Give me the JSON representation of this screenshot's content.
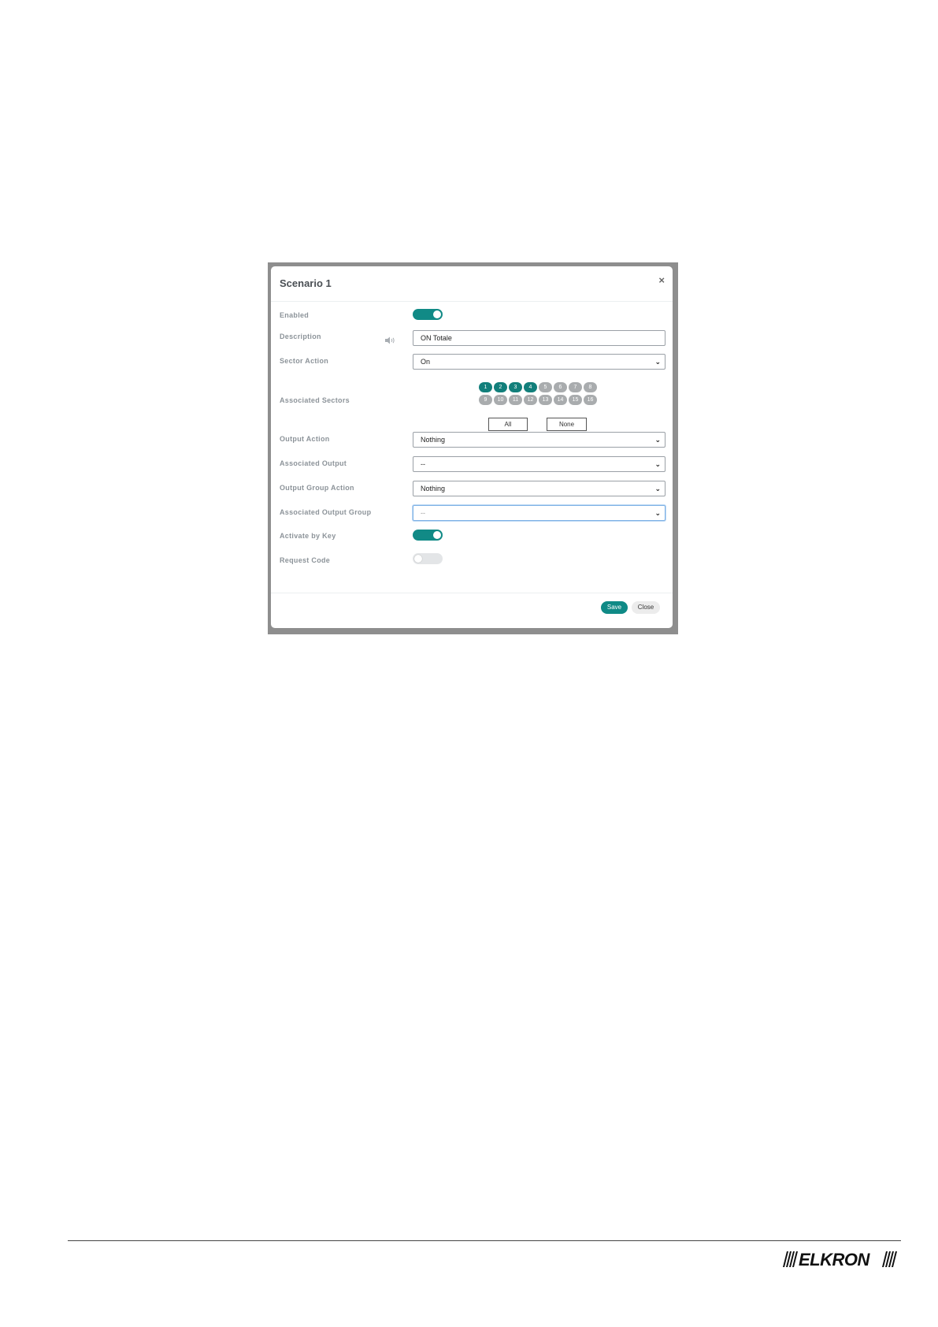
{
  "dialog": {
    "title": "Scenario 1",
    "close_icon": "close-icon"
  },
  "fields": {
    "enabled_label": "Enabled",
    "enabled_value": true,
    "description_label": "Description",
    "description_value": "ON  Totale",
    "sector_action_label": "Sector Action",
    "sector_action_value": "On",
    "associated_sectors_label": "Associated Sectors",
    "output_action_label": "Output Action",
    "output_action_value": "Nothing",
    "associated_output_label": "Associated Output",
    "associated_output_value": "--",
    "output_group_action_label": "Output Group Action",
    "output_group_action_value": "Nothing",
    "associated_output_group_label": "Associated Output Group",
    "associated_output_group_value": "--",
    "activate_by_key_label": "Activate by Key",
    "activate_by_key_value": true,
    "request_code_label": "Request Code",
    "request_code_value": false
  },
  "sectors": {
    "items": [
      {
        "label": "1",
        "selected": true
      },
      {
        "label": "2",
        "selected": true
      },
      {
        "label": "3",
        "selected": true
      },
      {
        "label": "4",
        "selected": true
      },
      {
        "label": "5",
        "selected": false
      },
      {
        "label": "6",
        "selected": false
      },
      {
        "label": "7",
        "selected": false
      },
      {
        "label": "8",
        "selected": false
      },
      {
        "label": "9",
        "selected": false
      },
      {
        "label": "10",
        "selected": false
      },
      {
        "label": "11",
        "selected": false
      },
      {
        "label": "12",
        "selected": false
      },
      {
        "label": "13",
        "selected": false
      },
      {
        "label": "14",
        "selected": false
      },
      {
        "label": "15",
        "selected": false
      },
      {
        "label": "16",
        "selected": false
      }
    ],
    "all_label": "All",
    "none_label": "None"
  },
  "buttons": {
    "save_label": "Save",
    "close_label": "Close"
  },
  "colors": {
    "accent": "#118a86",
    "chip_off": "#a9acae"
  },
  "footer": {
    "logo_text": "ELKRON"
  }
}
